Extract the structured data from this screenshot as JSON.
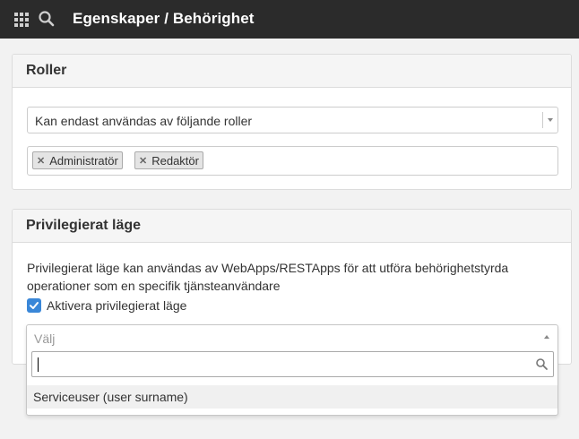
{
  "header": {
    "title": "Egenskaper / Behörighet",
    "icons": [
      "apps-grid-icon",
      "search-icon"
    ]
  },
  "roles_panel": {
    "title": "Roller",
    "mode_select": {
      "value": "Kan endast användas av följande roller"
    },
    "selected_roles": [
      "Administratör",
      "Redaktör"
    ]
  },
  "privileged_panel": {
    "title": "Privilegierat läge",
    "description": "Privilegierat läge kan användas av WebApps/RESTApps för att utföra behörighetstyrda operationer som en specifik tjänsteanvändare",
    "checkbox": {
      "label": "Aktivera privilegierat läge",
      "checked": true
    }
  },
  "user_select": {
    "placeholder": "Välj",
    "search_value": "",
    "options": [
      "Serviceuser (user surname)"
    ]
  },
  "colors": {
    "topbar": "#2b2b2b",
    "accent": "#3a87d8",
    "panel_header": "#f5f5f5"
  }
}
